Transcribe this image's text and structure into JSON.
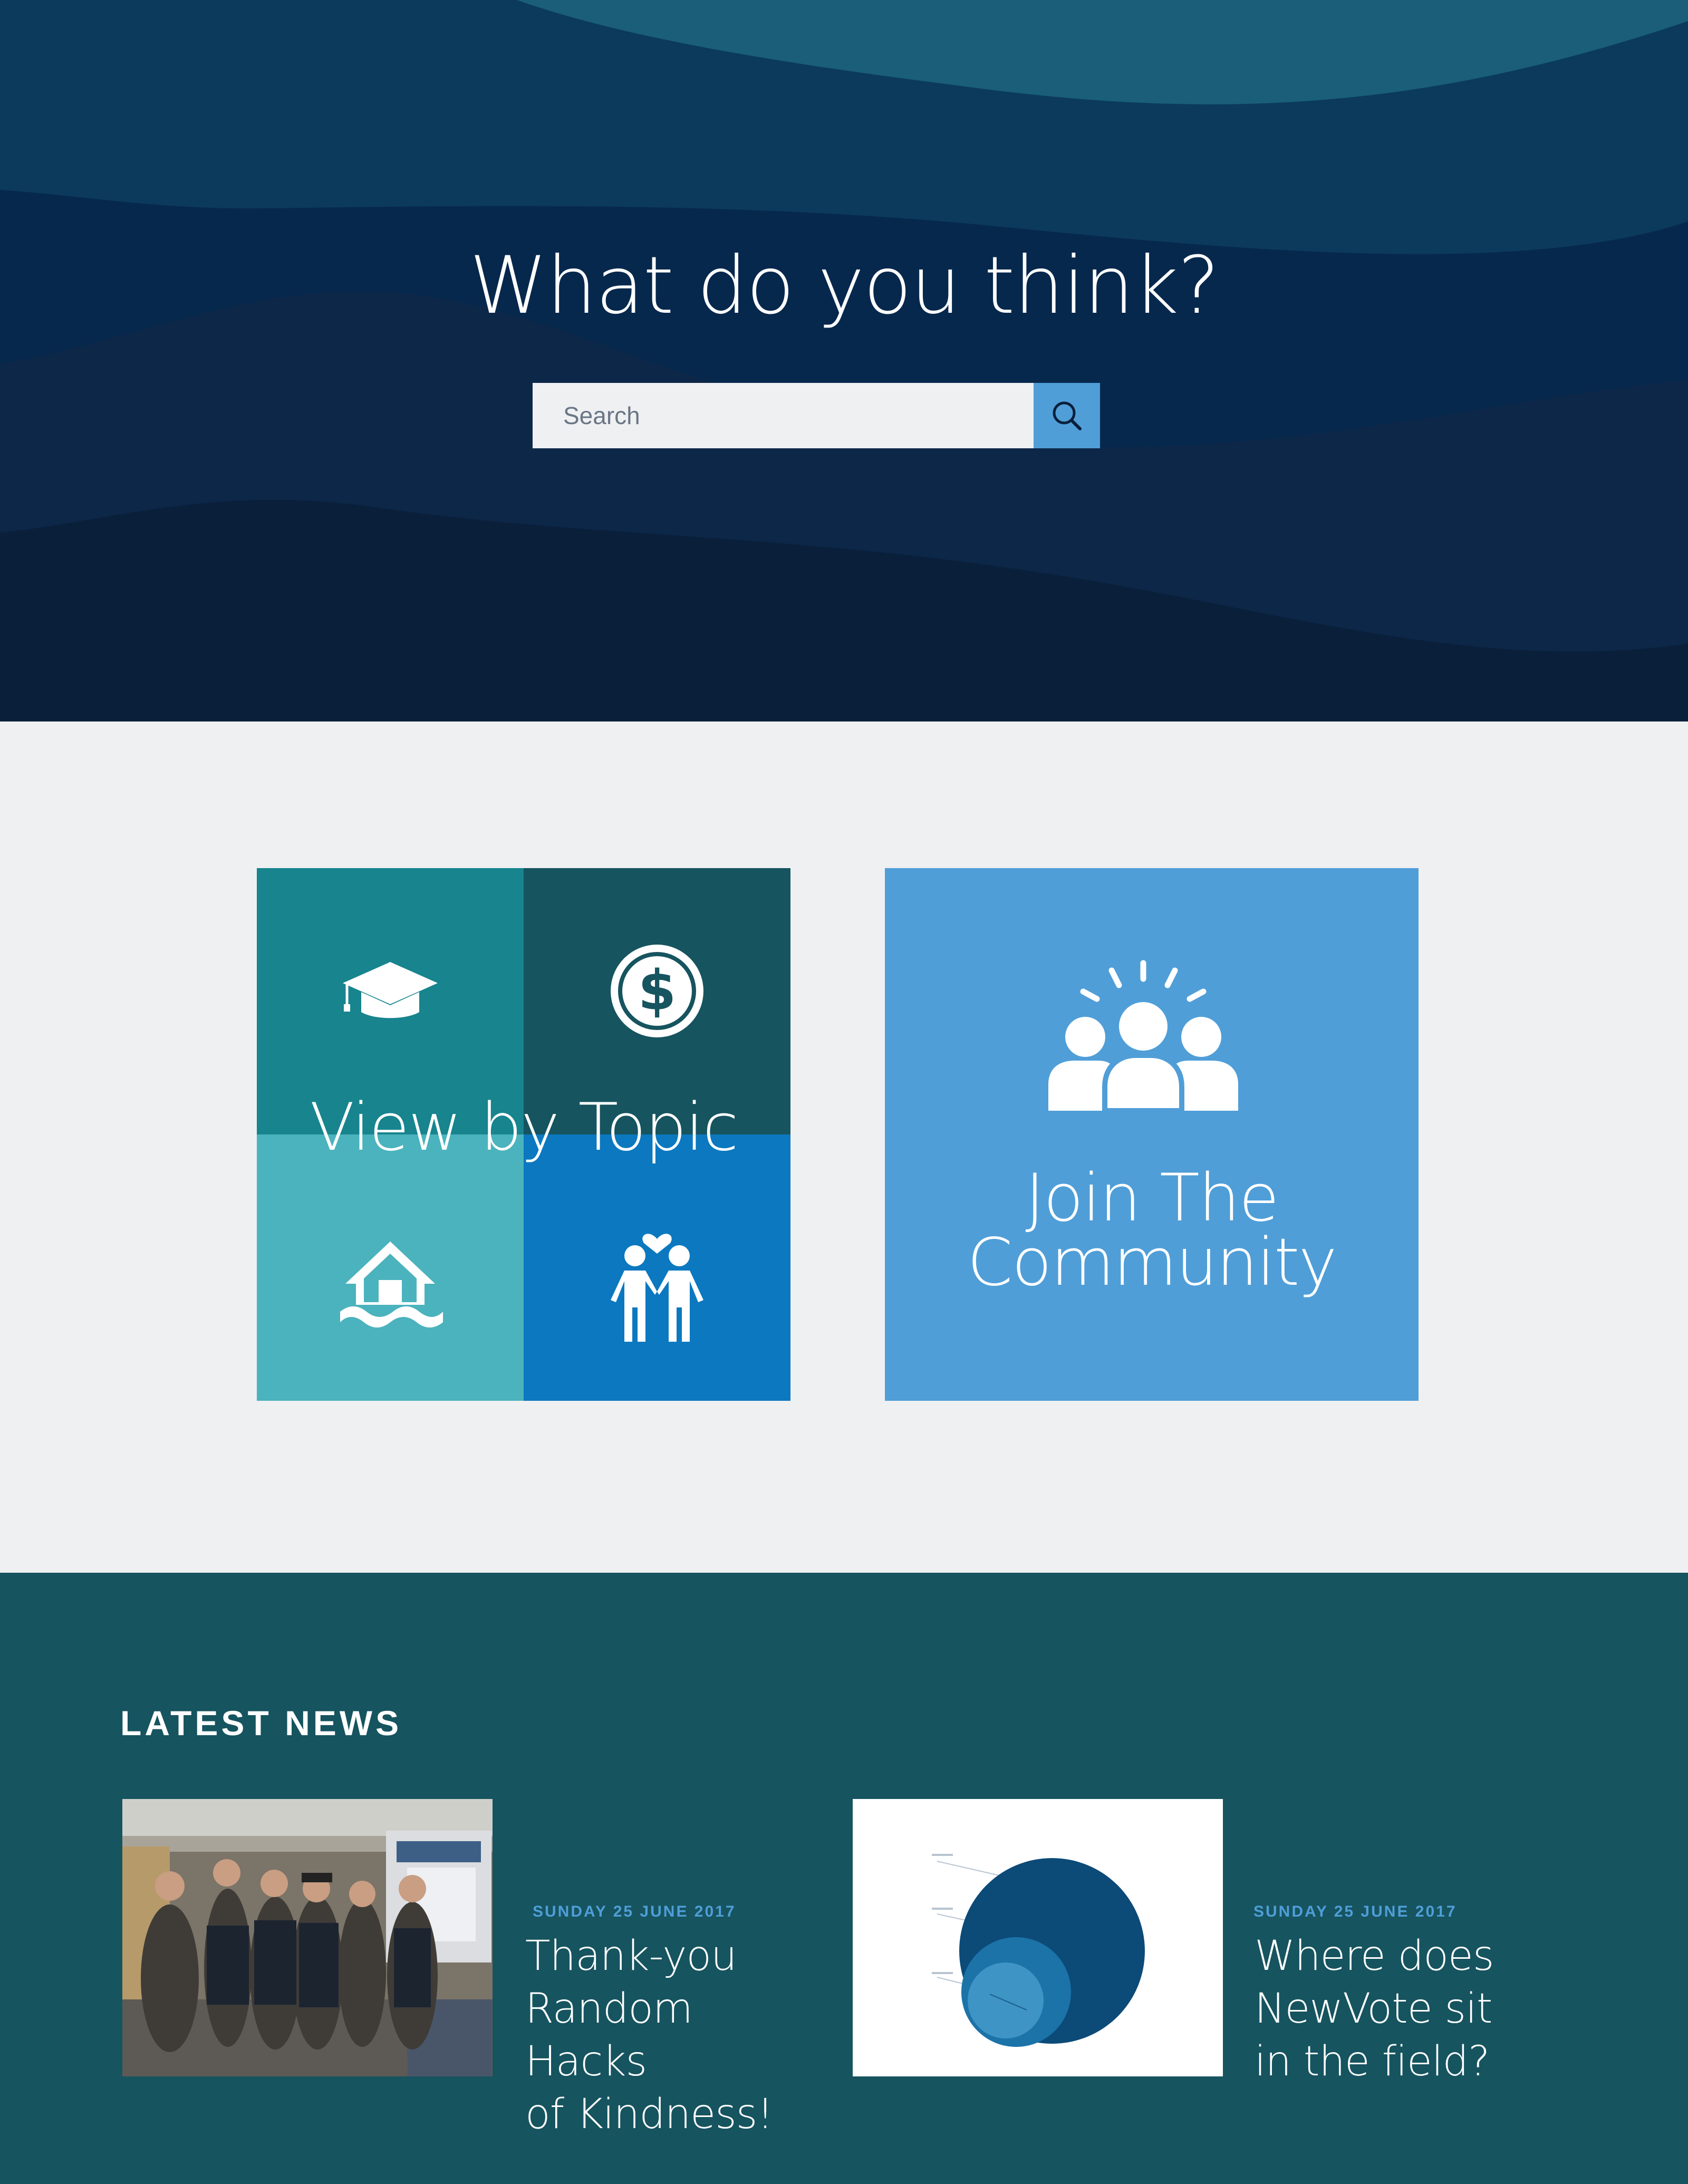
{
  "hero": {
    "title": "What do you think?",
    "search": {
      "placeholder": "Search",
      "value": ""
    },
    "search_button_icon": "search-icon"
  },
  "topics_card": {
    "label": "View by Topic",
    "tiles": [
      {
        "icon": "graduation-cap-icon",
        "color": "#17848e"
      },
      {
        "icon": "dollar-coin-icon",
        "color": "#16545f"
      },
      {
        "icon": "flooded-house-icon",
        "color": "#4bb3bd"
      },
      {
        "icon": "couple-heart-icon",
        "color": "#0b78c0"
      }
    ]
  },
  "community_card": {
    "label_line1": "Join The",
    "label_line2": "Community",
    "icon": "community-group-icon",
    "color": "#4f9ed8"
  },
  "news": {
    "heading": "LATEST NEWS",
    "items": [
      {
        "date": "SUNDAY 25 JUNE 2017",
        "title_lines": [
          "Thank-you",
          "Random Hacks",
          "of Kindness!"
        ],
        "image": "group-photo"
      },
      {
        "date": "SUNDAY 25 JUNE 2017",
        "title_lines": [
          "Where does",
          "NewVote sit",
          "in the field?"
        ],
        "image": "nested-circles-diagram"
      }
    ]
  },
  "colors": {
    "hero_dark": "#0a1f3a",
    "accent_blue": "#4f9ed8",
    "news_bg": "#16545f",
    "page_bg": "#eff0f2"
  }
}
